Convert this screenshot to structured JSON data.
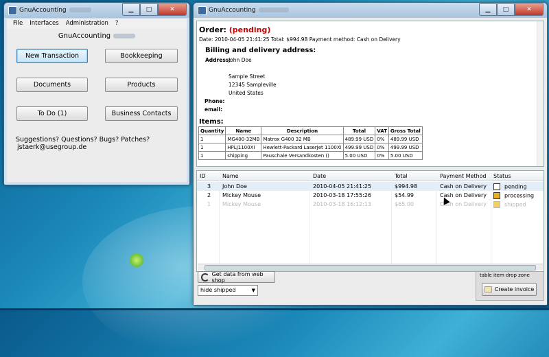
{
  "left_window": {
    "title": "GnuAccounting",
    "menu": [
      "File",
      "Interfaces",
      "Administration",
      "?"
    ],
    "heading": "GnuAccounting",
    "buttons": {
      "new_transaction": "New Transaction",
      "bookkeeping": "Bookkeeping",
      "documents": "Documents",
      "products": "Products",
      "todo": "To Do (1)",
      "contacts": "Business Contacts"
    },
    "suggestions": "Suggestions? Questions? Bugs? Patches?",
    "email": "jstaerk@usegroup.de"
  },
  "right_window": {
    "title": "GnuAccounting",
    "order": {
      "label": "Order:",
      "status": "(pending)",
      "meta": "Date: 2010-04-05 21:41:25 Total: $994.98 Payment method: Cash on Delivery",
      "billing_heading": "Billing and delivery address:",
      "address_label": "Address:",
      "name": "John Doe",
      "street": "Sample Street",
      "city": "12345 Sampleville",
      "country": "United States",
      "phone_label": "Phone:",
      "email_label": "email:",
      "items_heading": "Items:",
      "items_headers": [
        "Quantity",
        "Name",
        "Description",
        "Total",
        "VAT",
        "Gross Total"
      ],
      "items": [
        [
          "1",
          "MG400-32MB",
          "Matrox G400 32 MB",
          "489.99 USD",
          "0%",
          "489.99 USD"
        ],
        [
          "1",
          "HPLJ1100XI",
          "Hewlett-Packard LaserJet 1100Xi",
          "499.99 USD",
          "0%",
          "499.99 USD"
        ],
        [
          "1",
          "shipping",
          "Pauschale Versandkosten ()",
          "5.00 USD",
          "0%",
          "5.00 USD"
        ]
      ]
    },
    "grid": {
      "headers": {
        "id": "ID",
        "name": "Name",
        "date": "Date",
        "total": "Total",
        "payment": "Payment Method",
        "status": "Status"
      },
      "rows": [
        {
          "id": "3",
          "name": "John Doe",
          "date": "2010-04-05 21:41:25",
          "total": "$994.98",
          "payment": "Cash on Delivery",
          "status": "pending"
        },
        {
          "id": "2",
          "name": "Mickey Mouse",
          "date": "2010-03-18 17:55:26",
          "total": "$54.99",
          "payment": "Cash on Delivery",
          "status": "processing"
        },
        {
          "id": "1",
          "name": "Mickey Mouse",
          "date": "2010-03-18 16:12:13",
          "total": "$65.00",
          "payment": "Cash on Delivery",
          "status": "shipped"
        }
      ]
    },
    "web_shop_button": "Get data from web shop",
    "filter_select": "hide shipped",
    "drop_zone_label": "table item drop zone",
    "create_invoice": "Create invoice"
  },
  "colors": {
    "pending_red": "#cc0000",
    "selection_blue": "#e3eef9",
    "desktop_blue": "#1a87b8"
  }
}
